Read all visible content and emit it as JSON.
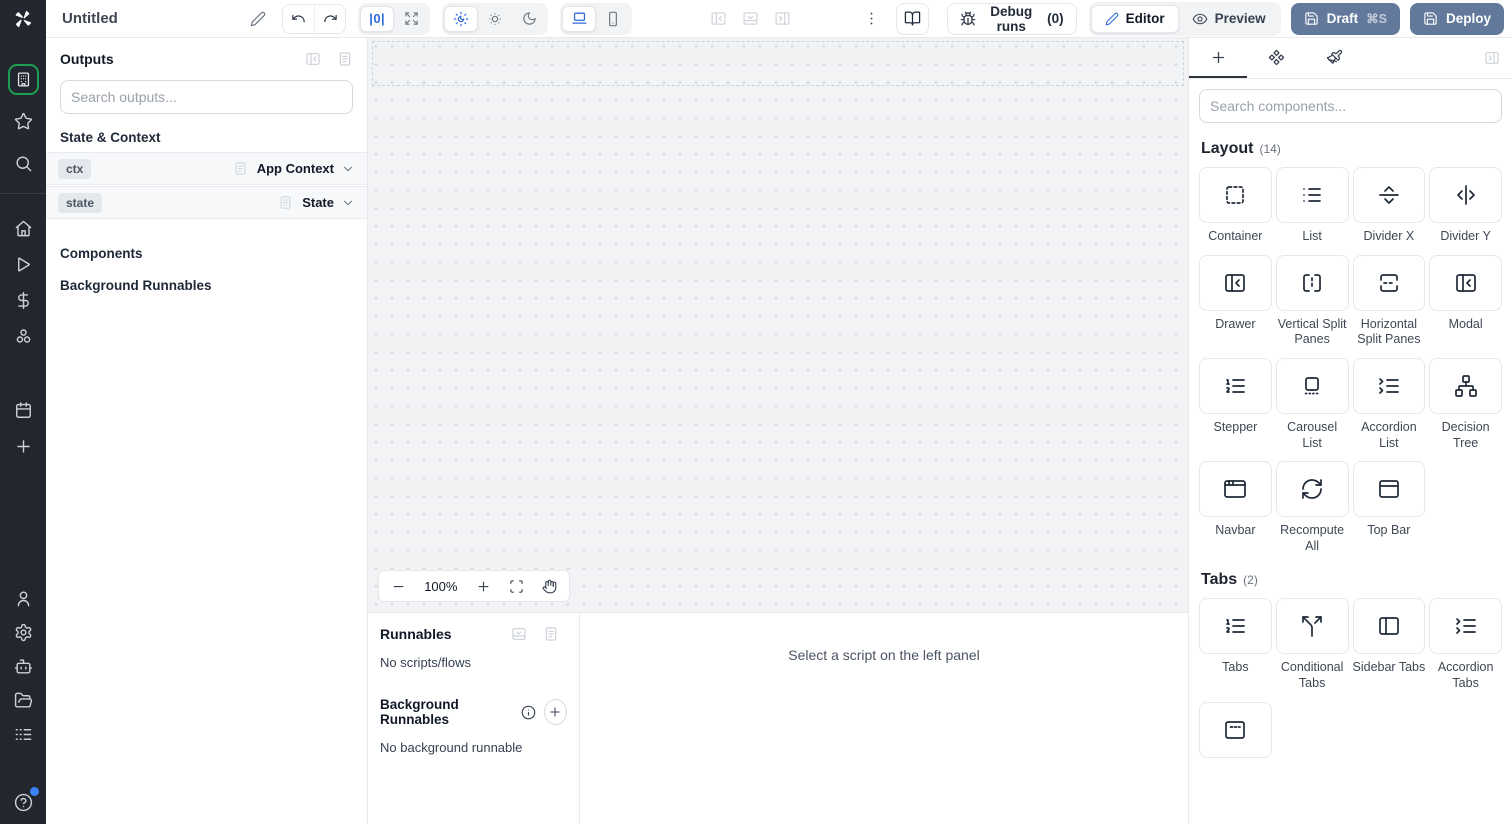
{
  "app": {
    "title": "Untitled"
  },
  "topbar": {
    "zero_glyph": "|0|",
    "debug_label": "Debug runs",
    "debug_count": "(0)",
    "editor_label": "Editor",
    "preview_label": "Preview",
    "draft_label": "Draft",
    "draft_shortcut": "⌘S",
    "deploy_label": "Deploy"
  },
  "outputs": {
    "title": "Outputs",
    "search_placeholder": "Search outputs...",
    "state_context_header": "State & Context",
    "rows": [
      {
        "badge": "ctx",
        "type": "App Context"
      },
      {
        "badge": "state",
        "type": "State"
      }
    ],
    "components_header": "Components",
    "background_header": "Background Runnables"
  },
  "canvas": {
    "zoom_level": "100%"
  },
  "runnables": {
    "title": "Runnables",
    "empty": "No scripts/flows",
    "background_title": "Background Runnables",
    "background_empty": "No background runnable",
    "select_hint": "Select a script on the left panel"
  },
  "components_panel": {
    "search_placeholder": "Search components...",
    "sections": [
      {
        "title": "Layout",
        "count": "(14)",
        "items": [
          {
            "label": "Container",
            "icon": "container"
          },
          {
            "label": "List",
            "icon": "list"
          },
          {
            "label": "Divider X",
            "icon": "divider-x"
          },
          {
            "label": "Divider Y",
            "icon": "divider-y"
          },
          {
            "label": "Drawer",
            "icon": "panel-left-close"
          },
          {
            "label": "Vertical Split Panes",
            "icon": "vsplit"
          },
          {
            "label": "Horizontal Split Panes",
            "icon": "hsplit"
          },
          {
            "label": "Modal",
            "icon": "panel-left-close"
          },
          {
            "label": "Stepper",
            "icon": "list-ordered"
          },
          {
            "label": "Carousel List",
            "icon": "carousel"
          },
          {
            "label": "Accordion List",
            "icon": "list-collapse"
          },
          {
            "label": "Decision Tree",
            "icon": "network"
          },
          {
            "label": "Navbar",
            "icon": "app-window"
          },
          {
            "label": "Recompute All",
            "icon": "refresh"
          },
          {
            "label": "Top Bar",
            "icon": "panel-top"
          }
        ]
      },
      {
        "title": "Tabs",
        "count": "(2)",
        "items": [
          {
            "label": "Tabs",
            "icon": "list-ordered"
          },
          {
            "label": "Conditional Tabs",
            "icon": "split"
          },
          {
            "label": "Sidebar Tabs",
            "icon": "panel-left"
          },
          {
            "label": "Accordion Tabs",
            "icon": "list-collapse"
          },
          {
            "label": "",
            "icon": "panel-top-dashed"
          }
        ]
      }
    ]
  },
  "sidebar": {
    "primary": [
      {
        "name": "workspace",
        "icon": "building",
        "ring": true
      },
      {
        "name": "favorites",
        "icon": "star"
      },
      {
        "name": "search",
        "icon": "search"
      }
    ],
    "secondary": [
      {
        "name": "home",
        "icon": "home"
      },
      {
        "name": "runs",
        "icon": "play"
      },
      {
        "name": "variables",
        "icon": "dollar"
      },
      {
        "name": "resources",
        "icon": "nodes"
      }
    ],
    "tertiary": [
      {
        "name": "schedules",
        "icon": "calendar"
      },
      {
        "name": "create",
        "icon": "plus"
      }
    ],
    "bottom": [
      {
        "name": "user",
        "icon": "user"
      },
      {
        "name": "settings",
        "icon": "gear"
      },
      {
        "name": "assistant",
        "icon": "bot"
      },
      {
        "name": "folders",
        "icon": "folder-open"
      },
      {
        "name": "logs",
        "icon": "logs"
      }
    ],
    "help": {
      "name": "help",
      "icon": "help",
      "dot": true
    }
  },
  "colors": {
    "accent_blue": "#2f6bde",
    "button_slate": "#62799c",
    "workspace_green": "#1ca04f",
    "canvas_bg": "#f2f3f5",
    "rail_dark": "#22262e"
  }
}
